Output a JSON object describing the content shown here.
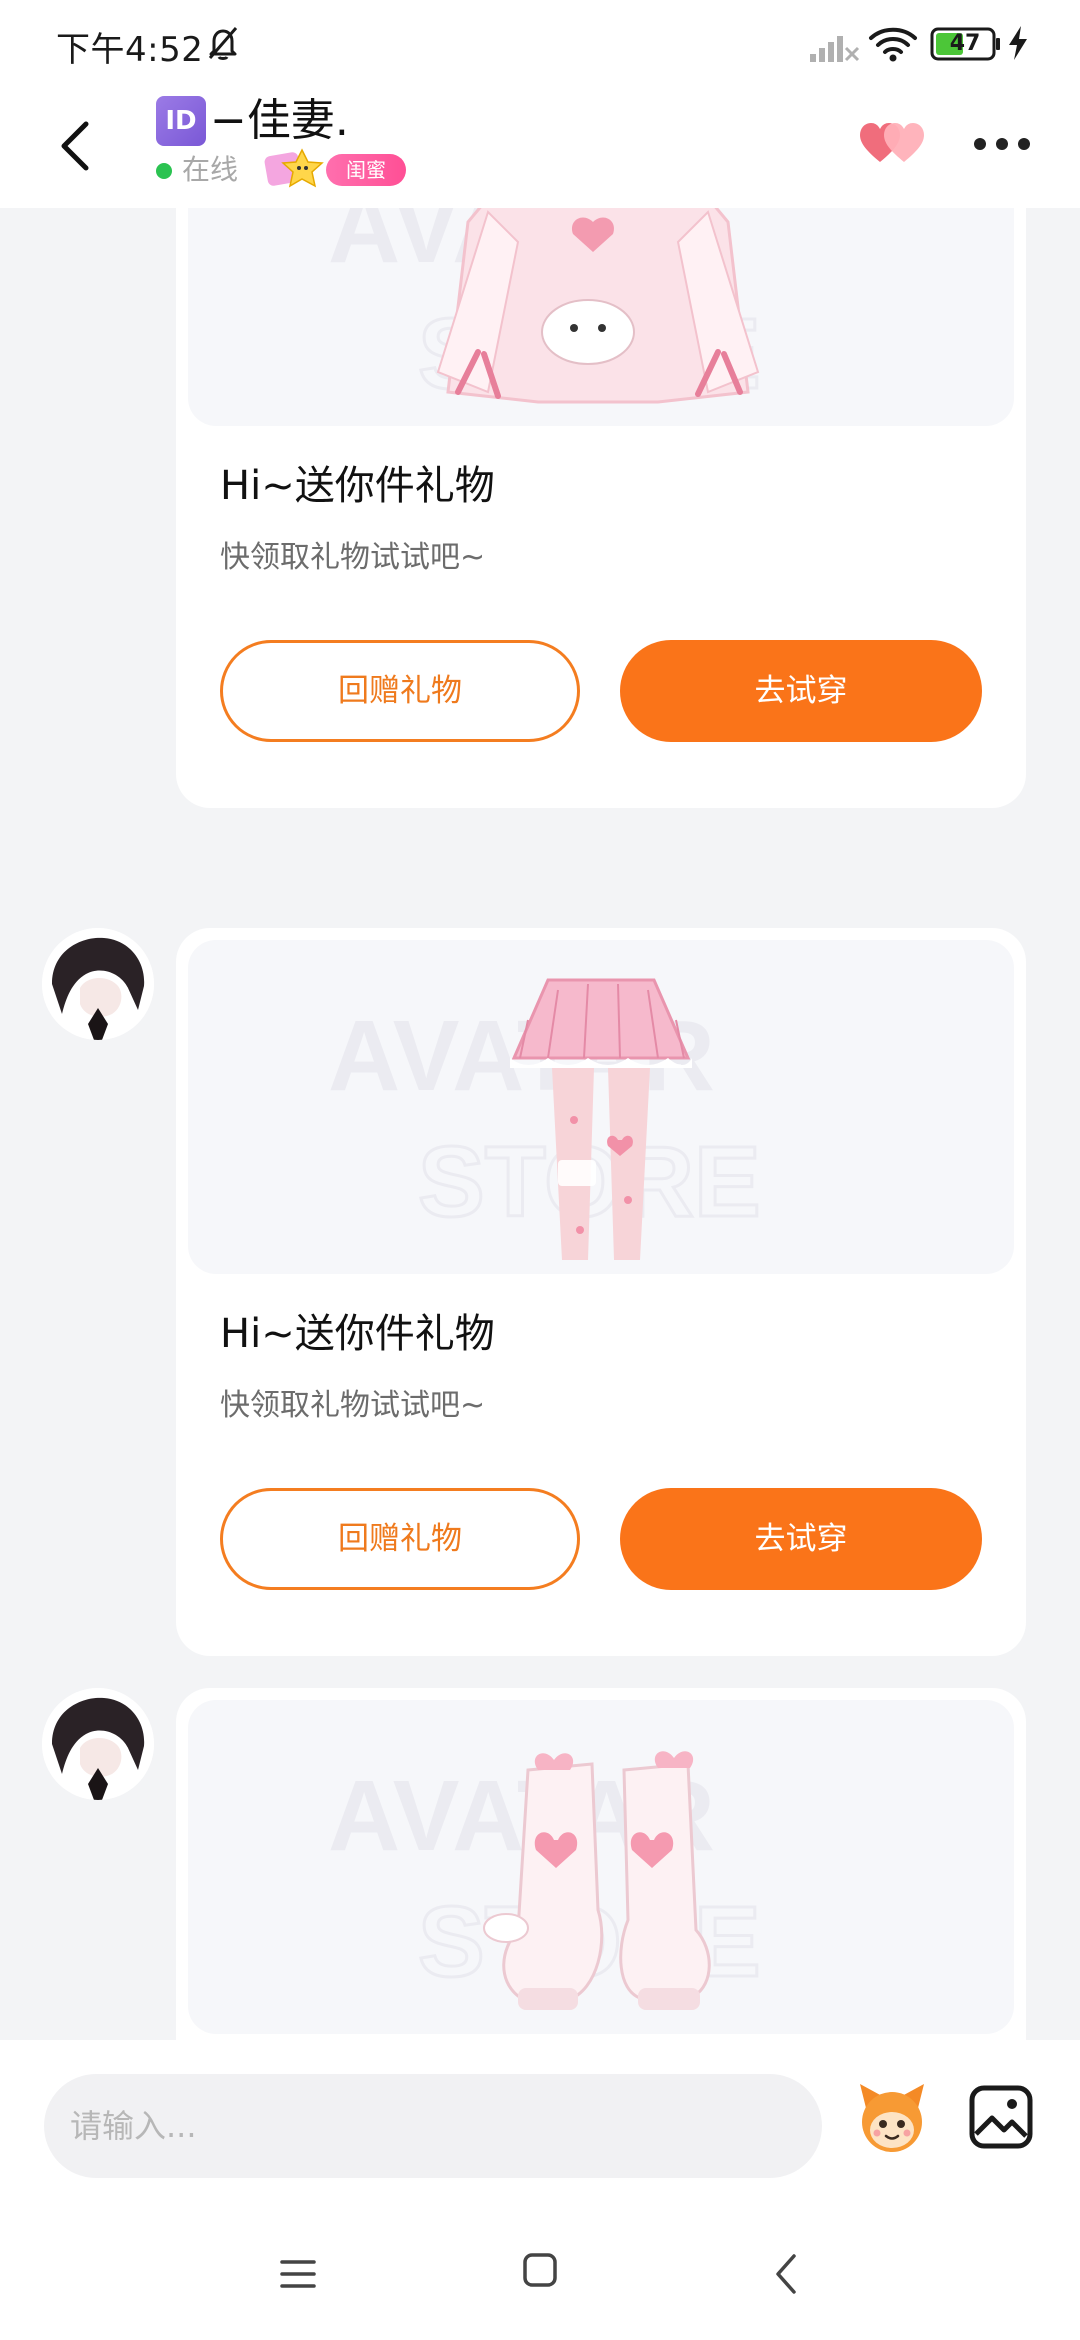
{
  "status_bar": {
    "time": "下午4:52",
    "battery": "47",
    "icons": [
      "bell-off-icon",
      "signal-icon",
      "wifi-icon",
      "battery-icon",
      "charging-icon"
    ]
  },
  "header": {
    "badge": "ID",
    "name": "−佳妻.",
    "status": "在线",
    "relation": "闺蜜",
    "icons": [
      "back-icon",
      "hearts-icon",
      "more-icon"
    ]
  },
  "messages": [
    {
      "item": "sweater",
      "title": "Hi~送你件礼物",
      "subtitle": "快领取礼物试试吧~",
      "return_label": "回赠礼物",
      "try_label": "去试穿"
    },
    {
      "item": "skirt",
      "title": "Hi~送你件礼物",
      "subtitle": "快领取礼物试试吧~",
      "return_label": "回赠礼物",
      "try_label": "去试穿"
    },
    {
      "item": "boots"
    }
  ],
  "watermark_text": [
    "AVATAR",
    "STORE"
  ],
  "input": {
    "placeholder": "请输入..."
  },
  "colors": {
    "accent": "#fa7419",
    "online": "#2bc351",
    "relation_tag": "#ff4f95",
    "page_bg": "#f3f4f6"
  }
}
